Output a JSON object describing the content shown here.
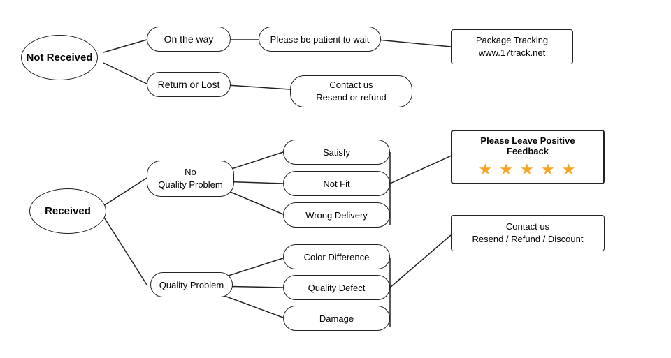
{
  "nodes": {
    "not_received": {
      "label": "Not\nReceived"
    },
    "received": {
      "label": "Received"
    },
    "on_the_way": {
      "label": "On the way"
    },
    "return_or_lost": {
      "label": "Return or Lost"
    },
    "patient": {
      "label": "Please be patient to wait"
    },
    "contact_resend_refund": {
      "label": "Contact us\nResend or refund"
    },
    "package_tracking": {
      "label": "Package Tracking\nwww.17track.net"
    },
    "no_quality_problem": {
      "label": "No\nQuality Problem"
    },
    "quality_problem": {
      "label": "Quality Problem"
    },
    "satisfy": {
      "label": "Satisfy"
    },
    "not_fit": {
      "label": "Not Fit"
    },
    "wrong_delivery": {
      "label": "Wrong Delivery"
    },
    "color_difference": {
      "label": "Color Difference"
    },
    "quality_defect": {
      "label": "Quality Defect"
    },
    "damage": {
      "label": "Damage"
    },
    "contact_resend_refund_discount": {
      "label": "Contact us\nResend / Refund / Discount"
    },
    "feedback_title": {
      "label": "Please Leave Positive Feedback"
    },
    "stars": {
      "label": "★ ★ ★ ★ ★"
    }
  }
}
